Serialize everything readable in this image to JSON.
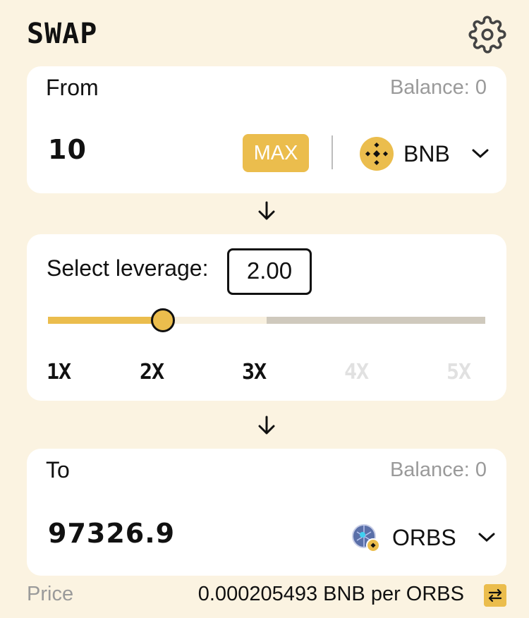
{
  "header": {
    "title": "SWAP",
    "settings_icon": "gear-icon"
  },
  "from": {
    "label": "From",
    "balance": "Balance: 0",
    "amount": "10",
    "max_label": "MAX",
    "token": {
      "symbol": "BNB",
      "icon": "bnb-logo-icon"
    }
  },
  "leverage": {
    "label": "Select leverage:",
    "value": "2.00",
    "slider_fraction": 0.25,
    "ticks": [
      "1X",
      "2X",
      "3X",
      "4X",
      "5X"
    ]
  },
  "to": {
    "label": "To",
    "balance": "Balance: 0",
    "amount": "97326.9",
    "token": {
      "symbol": "ORBS",
      "icon": "orbs-logo-icon"
    }
  },
  "price": {
    "label": "Price",
    "value": "0.000205493 BNB per ORBS"
  },
  "colors": {
    "accent": "#ebbd4d",
    "background": "#fbf3e1",
    "card": "#ffffff",
    "muted": "#9a9a9a"
  }
}
